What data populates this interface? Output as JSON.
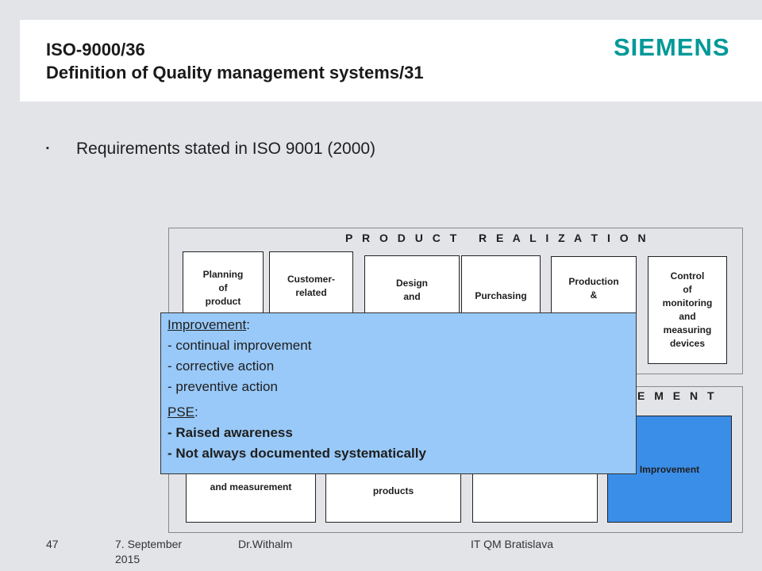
{
  "header": {
    "title_line1": "ISO-9000/36",
    "title_line2": "Definition of Quality management systems/31",
    "logo_text": "SIEMENS",
    "logo_color": "#009999"
  },
  "bullet": {
    "icon": "square-bullet-icon",
    "text": "Requirements stated in ISO 9001 (2000)"
  },
  "product_realization": {
    "title": "P R O D U C T   R E A L I Z A T I O N",
    "boxes": [
      "Planning\nof\nproduct",
      "Customer-\nrelated",
      "Design\nand",
      "Purchasing",
      "Production\n&",
      "Control\nof\nmonitoring\nand\nmeasuring\ndevices"
    ]
  },
  "measurement": {
    "title_visible": "E M E N T",
    "boxes": [
      "and measurement",
      "products",
      "",
      "Improvement"
    ]
  },
  "callout": {
    "heading1": "Improvement",
    "heading1_suffix": ":",
    "item1": "- continual improvement",
    "item2": "- corrective action",
    "item3": "- preventive action",
    "heading2": "PSE",
    "heading2_suffix": ":",
    "item4": "- Raised awareness",
    "item5": "- Not always documented systematically"
  },
  "footer": {
    "page_number": "47",
    "date_line1": "7. September",
    "date_line2": "2015",
    "author": "Dr.Withalm",
    "org": "IT QM Bratislava"
  },
  "colors": {
    "background": "#e2e4e8",
    "callout_fill": "#99c9f8",
    "improvement_box": "#3b8ee8"
  }
}
